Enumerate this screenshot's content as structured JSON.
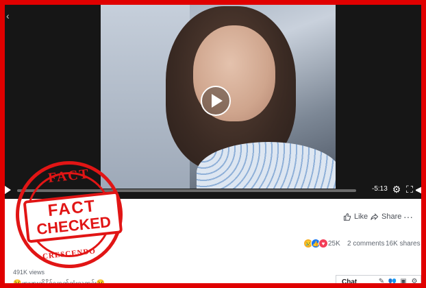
{
  "video": {
    "time_remaining": "-5:13",
    "controls": {
      "play_icon": "play-icon",
      "settings_icon": "gear-icon",
      "fullscreen_icon": "fullscreen-icon",
      "volume_icon": "volume-icon"
    }
  },
  "actions": {
    "like_label": "Like",
    "share_label": "Share"
  },
  "engagement": {
    "reactions_count": "25K",
    "comments": "2 comments",
    "shares": "16K shares",
    "views": "491K views",
    "caption": "😢ဖားဖားကိုနိုင်နောက်ဆုံးသတင်း😢"
  },
  "chat": {
    "label": "Chat"
  },
  "stamp": {
    "top_text": "FACT",
    "line1": "FACT",
    "line2": "CHECKED",
    "bottom_text": "CRESCENDO"
  },
  "colors": {
    "frame": "#e00000",
    "stamp": "#e11515",
    "facebook_blue": "#1877f2"
  }
}
